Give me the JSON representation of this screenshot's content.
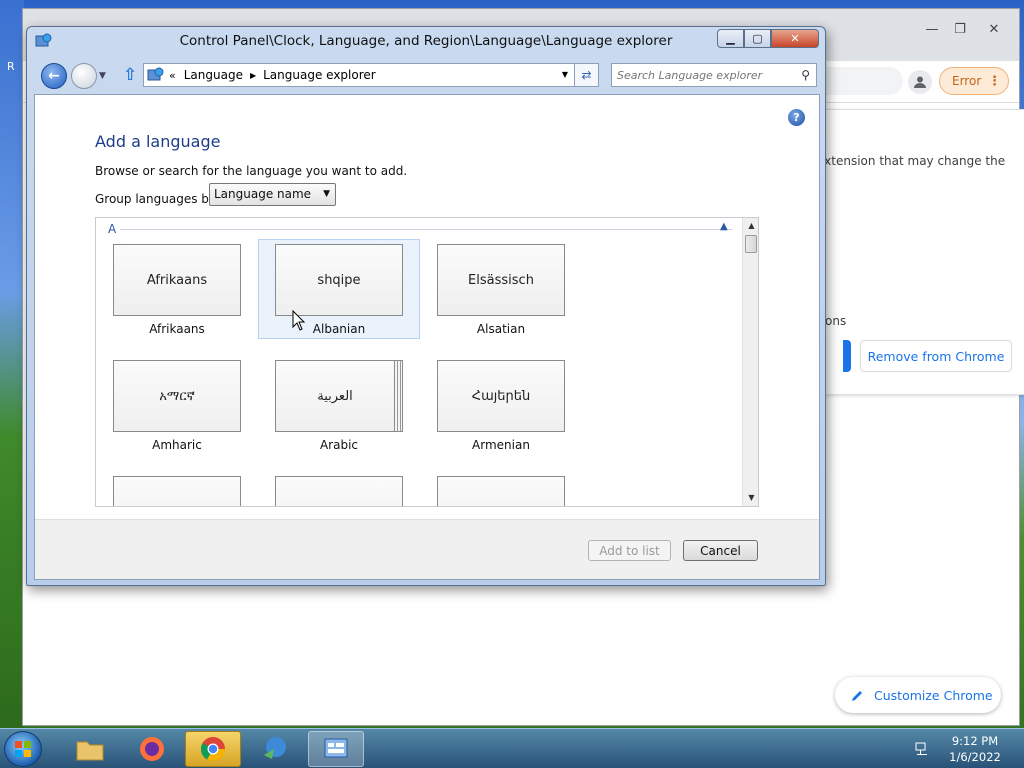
{
  "control_panel": {
    "title": "Control Panel\\Clock, Language, and Region\\Language\\Language explorer",
    "address": {
      "overflow": "«",
      "crumbs": [
        "Language",
        "Language explorer"
      ]
    },
    "search_placeholder": "Search Language explorer",
    "heading": "Add a language",
    "description": "Browse or search for the language you want to add.",
    "group_label": "Group languages by:",
    "group_select_value": "Language name",
    "group_header": "A",
    "languages": [
      {
        "native": "Afrikaans",
        "english": "Afrikaans"
      },
      {
        "native": "shqipe",
        "english": "Albanian"
      },
      {
        "native": "Elsässisch",
        "english": "Alsatian"
      },
      {
        "native": "አማርኛ",
        "english": "Amharic"
      },
      {
        "native": "العربية",
        "english": "Arabic"
      },
      {
        "native": "Հայերեն",
        "english": "Armenian"
      }
    ],
    "add_button": "Add to list",
    "cancel_button": "Cancel"
  },
  "chrome": {
    "error_label": "Error",
    "card_text_1": "extension that may change the",
    "card_text_2": "tions",
    "remove_button": "Remove from Chrome",
    "customize_button": "Customize Chrome"
  },
  "desktop": {
    "left_letter": "R"
  },
  "taskbar": {
    "time": "9:12 PM",
    "date": "1/6/2022"
  },
  "colors": {
    "chrome_blue": "#1a73e8",
    "error_orange": "#c5631b",
    "heading_blue": "#1e3d8a"
  }
}
